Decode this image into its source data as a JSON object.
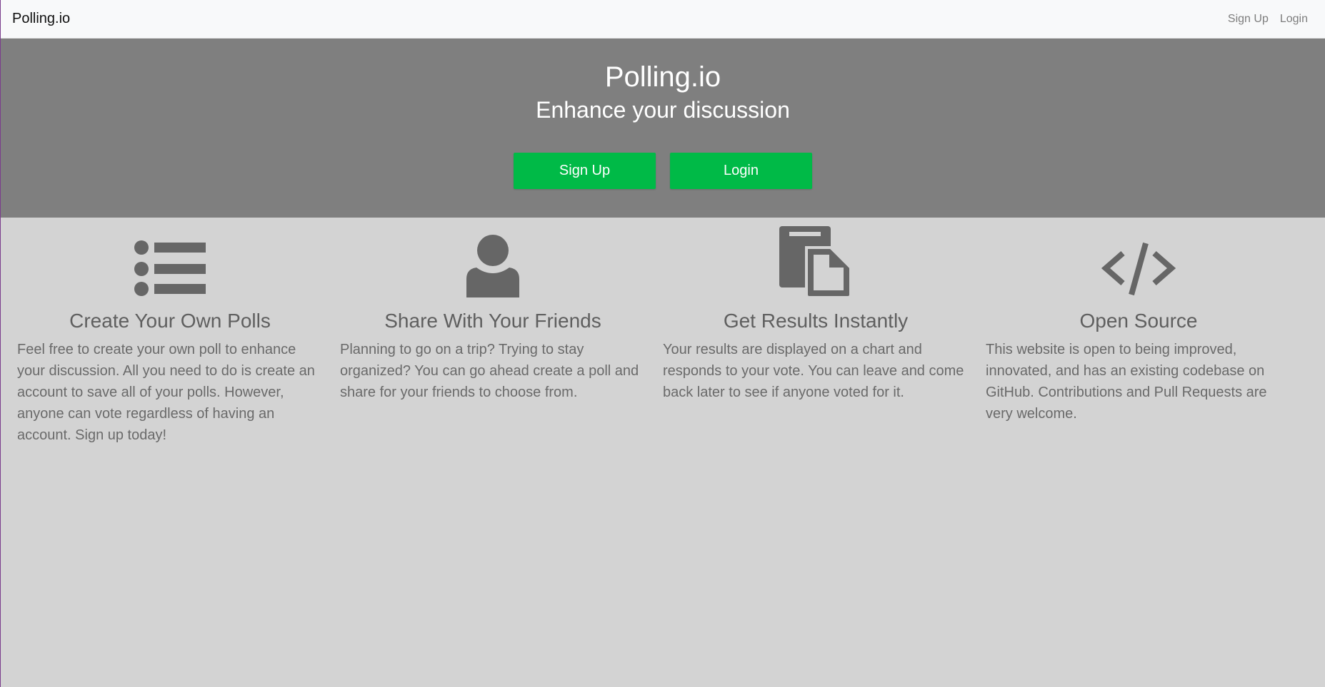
{
  "navbar": {
    "brand": "Polling.io",
    "links": [
      "Sign Up",
      "Login"
    ]
  },
  "hero": {
    "title": "Polling.io",
    "subtitle": "Enhance your discussion",
    "buttons": [
      "Sign Up",
      "Login"
    ]
  },
  "features": [
    {
      "icon": "list-icon",
      "title": "Create Your Own Polls",
      "text": "Feel free to create your own poll to enhance your discussion. All you need to do is create an account to save all of your polls. However, anyone can vote regardless of having an account. Sign up today!"
    },
    {
      "icon": "user-icon",
      "title": "Share With Your Friends",
      "text": "Planning to go on a trip? Trying to stay organized? You can go ahead create a poll and share for your friends to choose from."
    },
    {
      "icon": "copy-icon",
      "title": "Get Results Instantly",
      "text": "Your results are displayed on a chart and responds to your vote. You can leave and come back later to see if anyone voted for it."
    },
    {
      "icon": "code-icon",
      "title": "Open Source",
      "text": "This website is open to being improved, innovated, and has an existing codebase on GitHub. Contributions and Pull Requests are very welcome."
    }
  ],
  "colors": {
    "accent": "#00ba47",
    "hero_bg": "#7f7f7f",
    "body_bg": "#d3d3d3",
    "icon": "#666666"
  }
}
